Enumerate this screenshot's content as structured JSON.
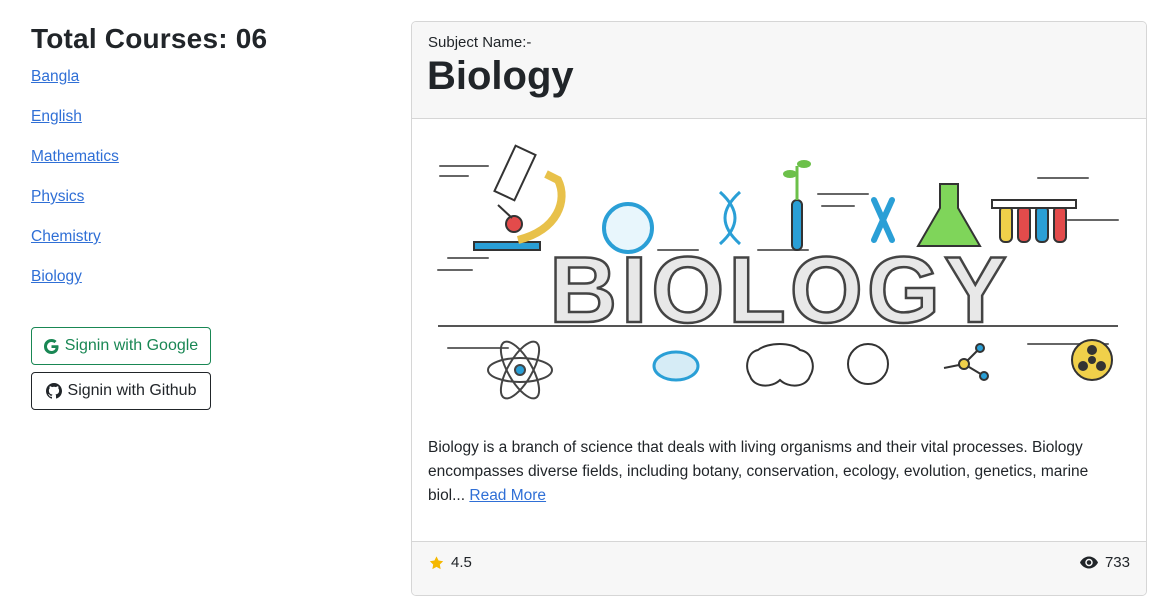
{
  "sidebar": {
    "total_title": "Total Courses: 06",
    "courses": [
      "Bangla",
      "English",
      "Mathematics",
      "Physics",
      "Chemistry",
      "Biology"
    ]
  },
  "auth": {
    "google_label": "Signin with Google",
    "github_label": "Signin with Github"
  },
  "card": {
    "subject_label": "Subject Name:-",
    "subject_name": "Biology",
    "image_word": "BIOLOGY",
    "description": "Biology is a branch of science that deals with living organisms and their vital processes. Biology encompasses diverse fields, including botany, conservation, ecology, evolution, genetics, marine biol...",
    "read_more": "Read More",
    "rating": "4.5",
    "views": "733"
  },
  "colors": {
    "link": "#2f6fd6",
    "google_green": "#198754",
    "star": "#f5b800",
    "card_header_bg": "#f7f7f7"
  },
  "icons": {
    "google": "google-icon",
    "github": "github-icon",
    "rating": "star-icon",
    "views": "eye-icon"
  }
}
